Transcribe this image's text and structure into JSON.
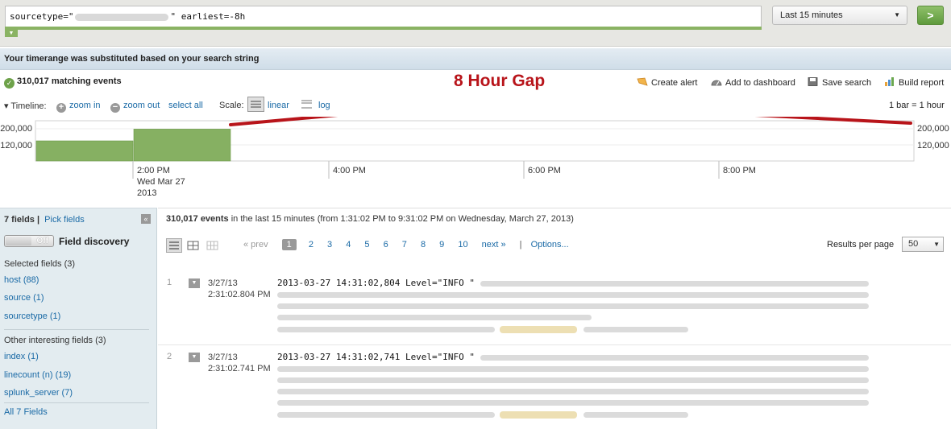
{
  "search": {
    "prefix": "sourcetype=\"",
    "suffix": "\" earliest=-8h",
    "time_range": "Last 15 minutes",
    "go_label": ">"
  },
  "notice": "Your timerange was substituted based on your search string",
  "header": {
    "matching": "310,017 matching events",
    "annotation": "8 Hour Gap",
    "actions": [
      "Create alert",
      "Add to dashboard",
      "Save search",
      "Build report"
    ]
  },
  "timeline": {
    "label": "Timeline:",
    "zoom_in": "zoom in",
    "zoom_out": "zoom out",
    "select_all": "select all",
    "scale_label": "Scale:",
    "scale_linear": "linear",
    "scale_log": "log",
    "bar_span": "1 bar = 1 hour"
  },
  "chart_data": {
    "type": "bar",
    "y_ticks": [
      "200,000",
      "120,000"
    ],
    "x_ticks": [
      {
        "label": "2:00 PM",
        "sub1": "Wed Mar 27",
        "sub2": "2013"
      },
      {
        "label": "4:00 PM"
      },
      {
        "label": "6:00 PM"
      },
      {
        "label": "8:00 PM"
      }
    ],
    "bars": [
      {
        "start": "12:30 PM",
        "value": 120000
      },
      {
        "start": "1:30 PM",
        "value": 190000
      }
    ],
    "ylim": [
      0,
      240000
    ],
    "bar_color": "#86b062",
    "annotation_color": "#b8141a"
  },
  "sidebar": {
    "fields_count": "7 fields",
    "divider": "|",
    "pick_fields": "Pick fields",
    "toggle": "Off",
    "field_discovery": "Field discovery",
    "selected_header": "Selected fields (3)",
    "selected": [
      "host (88)",
      "source (1)",
      "sourcetype (1)"
    ],
    "other_header": "Other interesting fields (3)",
    "other": [
      "index (1)",
      "linecount (n) (19)",
      "splunk_server (7)"
    ],
    "all_fields": "All 7 Fields"
  },
  "main": {
    "summary_bold": "310,017 events",
    "summary_rest": " in the last 15 minutes (from 1:31:02 PM to 9:31:02 PM on Wednesday, March 27, 2013)",
    "pager": {
      "prev": "« prev",
      "pages": [
        "1",
        "2",
        "3",
        "4",
        "5",
        "6",
        "7",
        "8",
        "9",
        "10"
      ],
      "next": "next »",
      "sep": "|",
      "options": "Options..."
    },
    "rpp_label": "Results per page",
    "rpp_value": "50",
    "events": [
      {
        "num": "1",
        "date": "3/27/13",
        "time": "2:31:02.804 PM",
        "raw": "2013-03-27 14:31:02,804 Level=\"INFO \""
      },
      {
        "num": "2",
        "date": "3/27/13",
        "time": "2:31:02.741 PM",
        "raw": "2013-03-27 14:31:02,741 Level=\"INFO \""
      }
    ]
  }
}
